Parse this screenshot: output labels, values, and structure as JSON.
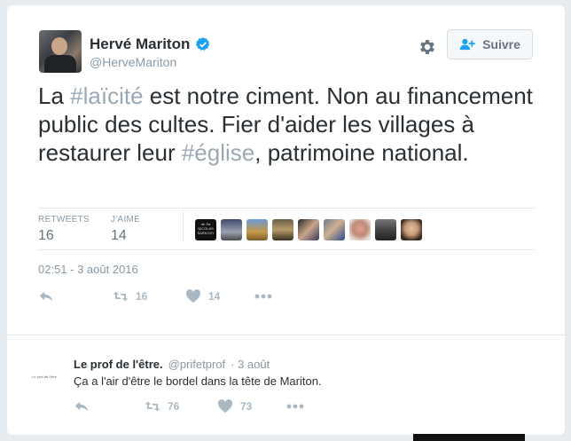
{
  "tweet": {
    "author_name": "Hervé Mariton",
    "author_handle": "@HerveMariton",
    "follow_label": "Suivre",
    "text_parts": [
      "La ",
      "#laïcité",
      " est notre ciment. Non au financement public des cultes. Fier d'aider les villages à restaurer leur ",
      "#église",
      ", patrimoine national."
    ],
    "stats": {
      "retweets_label": "RETWEETS",
      "retweets_value": "16",
      "likes_label": "J'AIME",
      "likes_value": "14"
    },
    "likers_avatar_texts": [
      "de Sa NICOLAS SARKOZY"
    ],
    "timestamp": "02:51 - 3 août 2016",
    "actions": {
      "retweet_count": "16",
      "like_count": "14"
    }
  },
  "reply": {
    "avatar_text": "Le prof de l'être",
    "author_name": "Le prof de l'être.",
    "author_handle": "@prifetprof",
    "time": "· 3 août",
    "text": "Ça a l'air d'être le bordel dans la tête de Mariton.",
    "actions": {
      "retweet_count": "76",
      "like_count": "73"
    }
  },
  "colors": {
    "text": "#292f33",
    "muted": "#8899a6",
    "hashtag": "#99aab5",
    "verified": "#1da1f2",
    "action_gray": "#aab8c2"
  },
  "icons": [
    "verified-icon",
    "gear-icon",
    "follow-person-icon",
    "reply-icon",
    "retweet-icon",
    "heart-icon",
    "more-icon"
  ]
}
